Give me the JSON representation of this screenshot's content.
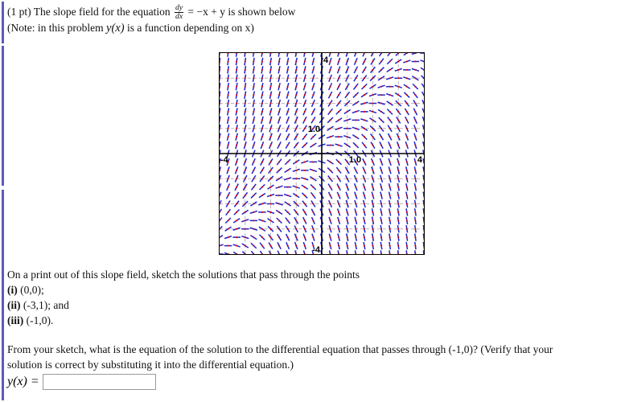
{
  "problem": {
    "points_label": "(1 pt)",
    "line1_prefix": "The slope field for the equation",
    "equation_numerator": "dy",
    "equation_denominator": "dx",
    "equation_rhs": "= −x + y",
    "line1_suffix": "is shown below",
    "note_prefix": "(Note: in this problem",
    "note_function": "y(x)",
    "note_suffix": "is a function depending on x)"
  },
  "instructions": {
    "sketch_line": "On a print out of this slope field, sketch the solutions that pass through the points",
    "items": [
      {
        "marker": "(i)",
        "text": "(0,0);"
      },
      {
        "marker": "(ii)",
        "text": "(-3,1); and"
      },
      {
        "marker": "(iii)",
        "text": "(-1,0)."
      }
    ]
  },
  "question": {
    "line1": "From your sketch, what is the equation of the solution to the differential equation that passes through (-1,0)? (Verify that your",
    "line2": "solution is correct by substituting it into the differential equation.)",
    "answer_label": "y(x) =",
    "answer_value": "",
    "answer_placeholder": ""
  },
  "chart_data": {
    "type": "scatter",
    "subtype": "slope-field",
    "title": "",
    "xlabel": "",
    "ylabel": "",
    "equation": "dy/dx = -x + y",
    "xlim": [
      -4,
      4
    ],
    "ylim": [
      -4,
      4
    ],
    "grid": true,
    "grid_step": 1,
    "grid_color": "#b8b8b8",
    "axis_color": "#000000",
    "segment_color": "#2222cc",
    "point_color": "#dd0000",
    "sample_step": 0.3333,
    "segment_length": 0.3,
    "tick_labels": [
      {
        "text": "4",
        "axis": "y",
        "value": 4,
        "position": "top"
      },
      {
        "text": "-4",
        "axis": "y",
        "value": -4,
        "position": "bottom"
      },
      {
        "text": "4",
        "axis": "x",
        "value": 4,
        "position": "right"
      },
      {
        "text": "-4",
        "axis": "x",
        "value": -4,
        "position": "left"
      },
      {
        "text": "1.0",
        "axis": "y",
        "value": 1,
        "position": "inner"
      },
      {
        "text": "1.0",
        "axis": "x",
        "value": 1,
        "position": "inner"
      }
    ],
    "marked_solution_points": [
      {
        "x": 0,
        "y": 0
      },
      {
        "x": -3,
        "y": 1
      },
      {
        "x": -1,
        "y": 0
      }
    ]
  },
  "colors": {
    "accent_rule": "#5b5bbb",
    "text": "#111111",
    "slope_segment": "#2222cc",
    "base_point": "#dd0000",
    "grid": "#b8b8b8",
    "input_border": "#9a9a9a"
  }
}
